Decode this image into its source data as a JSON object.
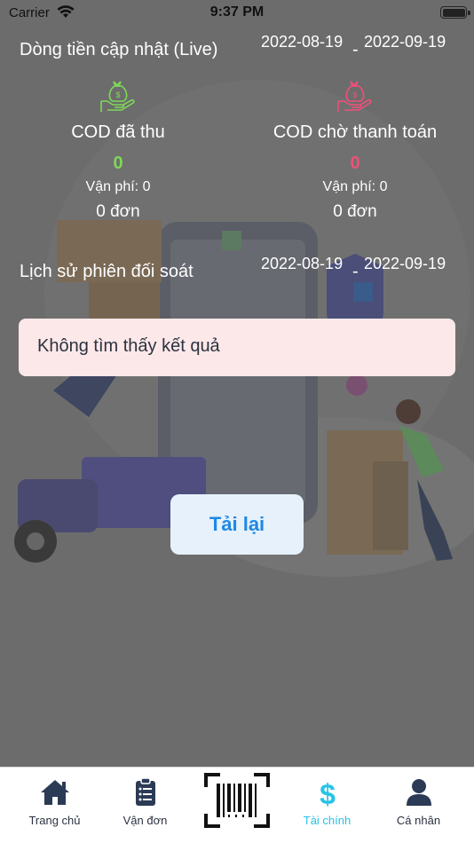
{
  "status_bar": {
    "carrier": "Carrier",
    "time": "9:37 PM"
  },
  "cashflow": {
    "title": "Dòng tiền cập nhật (Live)",
    "date_from": "2022-08-19",
    "date_to": "2022-09-19",
    "separator": "-"
  },
  "cod_collected": {
    "label": "COD đã thu",
    "value": "0",
    "fee": "Vận phí: 0",
    "orders": "0 đơn",
    "color": "#7ed957",
    "icon": "money-bag-hand-icon"
  },
  "cod_pending": {
    "label": "COD chờ thanh toán",
    "value": "0",
    "fee": "Vận phí: 0",
    "orders": "0 đơn",
    "color": "#f0507a",
    "icon": "money-bag-hand-icon"
  },
  "history": {
    "title": "Lịch sử phiên đối soát",
    "date_from": "2022-08-19",
    "date_to": "2022-09-19",
    "separator": "-"
  },
  "empty_message": "Không tìm thấy kết quả",
  "reload_label": "Tải lại",
  "tabs": [
    {
      "label": "Trang chủ",
      "icon": "home-icon"
    },
    {
      "label": "Vận đơn",
      "icon": "clipboard-icon"
    },
    {
      "label": "",
      "icon": "barcode-scan-icon"
    },
    {
      "label": "Tài chính",
      "icon": "dollar-icon",
      "active": true
    },
    {
      "label": "Cá nhân",
      "icon": "user-icon"
    }
  ],
  "colors": {
    "accent": "#1e88e5",
    "active_tab": "#27c3e6",
    "overlay": "#6a6a6a"
  }
}
